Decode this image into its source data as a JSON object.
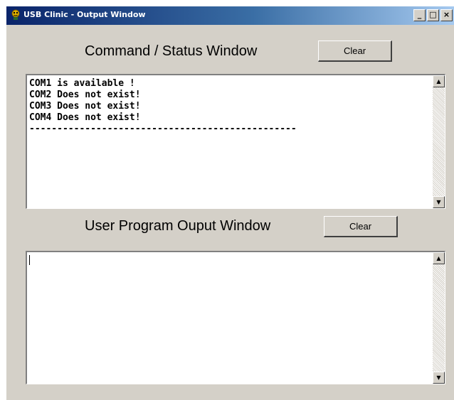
{
  "window": {
    "title": "USB Clinic - Output Window",
    "controls": {
      "minimize_glyph": "_",
      "maximize_glyph": "□",
      "close_glyph": "×"
    }
  },
  "command_status": {
    "label": "Command / Status Window",
    "clear_label": "Clear",
    "lines": [
      "COM1 is available !",
      "COM2 Does not exist!",
      "COM3 Does not exist!",
      "COM4 Does not exist!",
      "------------------------------------------------"
    ]
  },
  "user_output": {
    "label": "User Program Ouput Window",
    "clear_label": "Clear",
    "value": ""
  },
  "scrollbar": {
    "up_glyph": "▲",
    "down_glyph": "▼"
  },
  "colors": {
    "face": "#d4d0c8",
    "title_start": "#0a246a",
    "title_end": "#a6caf0"
  }
}
